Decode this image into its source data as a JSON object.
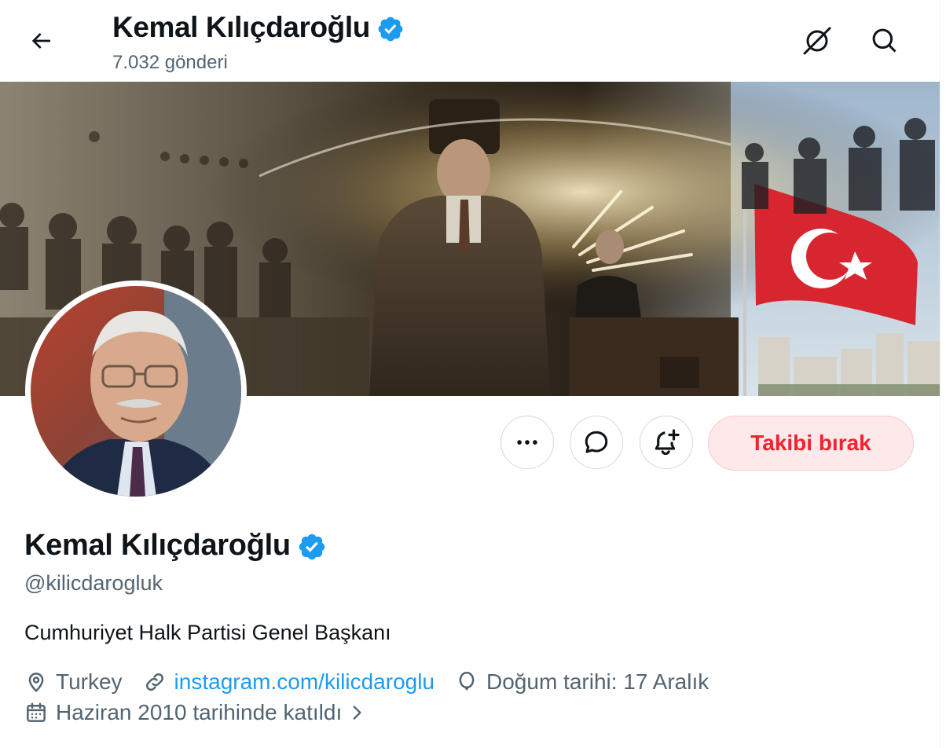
{
  "header": {
    "title": "Kemal Kılıçdaroğlu",
    "post_count": "7.032 gönderi"
  },
  "profile": {
    "name": "Kemal Kılıçdaroğlu",
    "handle": "@kilicdarogluk",
    "bio": "Cumhuriyet Halk Partisi Genel Başkanı",
    "location": "Turkey",
    "website": "instagram.com/kilicdaroglu",
    "birth_date": "Doğum tarihi: 17 Aralık",
    "joined": "Haziran 2010 tarihinde katıldı"
  },
  "actions": {
    "unfollow_label": "Takibi bırak"
  },
  "colors": {
    "verified_blue": "#1d9bf0",
    "unfollow_red": "#f4212e",
    "link_blue": "#1d9bf0",
    "secondary_text": "#536471"
  },
  "icons": {
    "back": "arrow-left-icon",
    "grok": "grok-icon",
    "search": "search-icon",
    "more": "more-dots-icon",
    "message": "message-icon",
    "notify": "bell-plus-icon",
    "verified": "verified-badge-icon",
    "location": "location-pin-icon",
    "link": "link-icon",
    "birthday": "balloon-icon",
    "calendar": "calendar-icon",
    "chevron": "chevron-right-icon"
  }
}
